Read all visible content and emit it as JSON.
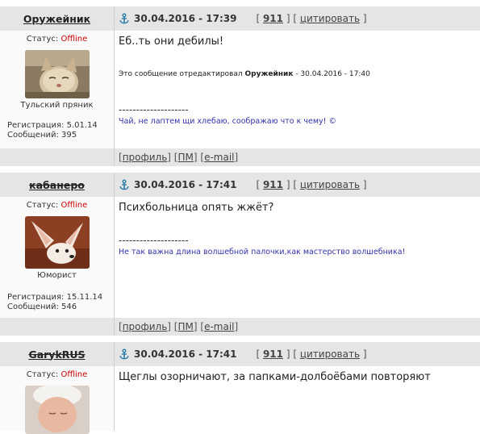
{
  "posts": [
    {
      "username": "Оружейник",
      "date": "30.04.2016 - 17:39",
      "post_number": "911",
      "quote_label": "цитировать",
      "status_label": "Статус:",
      "status_value": "Offline",
      "rank": "Тульский пряник",
      "reg_line": "Регистрация: 5.01.14",
      "msgs_line": "Сообщений: 395",
      "message": "Еб..ть они дебилы!",
      "edited_prefix": "Это сообщение отредактировал",
      "edited_user": "Оружейник",
      "edited_suffix": "- 30.04.2016 - 17:40",
      "sig_line": "--------------------",
      "signature": "Чай, не лаптем щи хлебаю, соображаю что к чему! ©",
      "profile_label": "профиль",
      "pm_label": "ПМ",
      "email_label": "e-mail"
    },
    {
      "username": "кабанеро",
      "date": "30.04.2016 - 17:41",
      "post_number": "911",
      "quote_label": "цитировать",
      "status_label": "Статус:",
      "status_value": "Offline",
      "rank": "Юморист",
      "reg_line": "Регистрация: 15.11.14",
      "msgs_line": "Сообщений: 546",
      "message": "Психбольница опять жжёт?",
      "sig_line": "--------------------",
      "signature": "Не так важна длина волшебной палочки,как мастерство волшебника!",
      "profile_label": "профиль",
      "pm_label": "ПМ",
      "email_label": "e-mail"
    },
    {
      "username": "GarykRUS",
      "date": "30.04.2016 - 17:41",
      "post_number": "911",
      "quote_label": "цитировать",
      "status_label": "Статус:",
      "status_value": "Offline",
      "message": "Щеглы озорничают, за папками-долбоёбами повторяют"
    }
  ]
}
